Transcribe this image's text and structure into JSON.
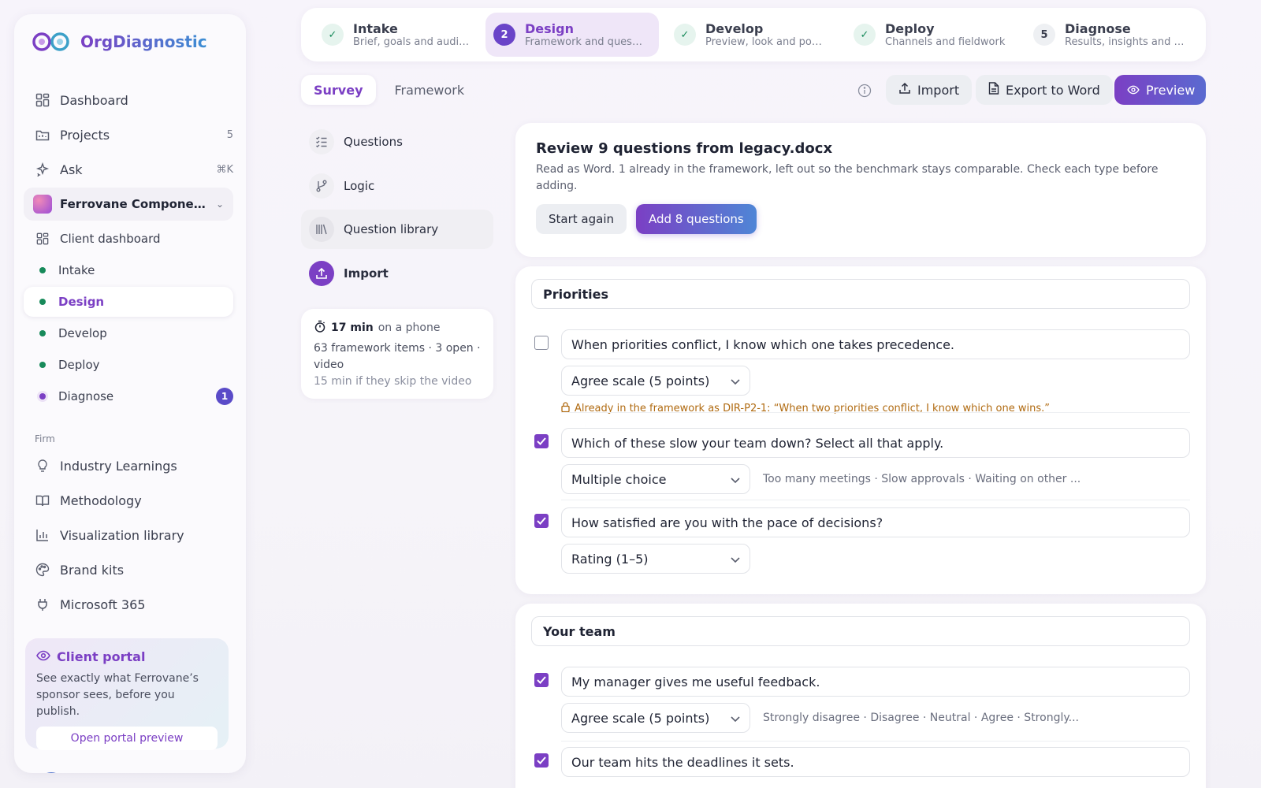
{
  "brand": {
    "name": "OrgDiagnostic"
  },
  "nav": [
    {
      "label": "Dashboard",
      "icon": "dashboard-icon"
    },
    {
      "label": "Projects",
      "icon": "folder-icon",
      "count": "5"
    },
    {
      "label": "Ask",
      "icon": "sparkle-icon",
      "count": "⌘K"
    }
  ],
  "client": {
    "name": "Ferrovane Compone..."
  },
  "client_nav": [
    {
      "label": "Client dashboard"
    },
    {
      "label": "Intake"
    },
    {
      "label": "Design"
    },
    {
      "label": "Develop"
    },
    {
      "label": "Deploy"
    },
    {
      "label": "Diagnose",
      "badge": "1"
    }
  ],
  "firm": {
    "label": "Firm",
    "items": [
      {
        "label": "Industry Learnings",
        "icon": "lightbulb-icon"
      },
      {
        "label": "Methodology",
        "icon": "book-icon"
      },
      {
        "label": "Visualization library",
        "icon": "bar-chart-icon"
      },
      {
        "label": "Brand kits",
        "icon": "palette-icon"
      },
      {
        "label": "Microsoft 365",
        "icon": "plug-icon"
      }
    ]
  },
  "portal": {
    "title": "Client portal",
    "desc": "See exactly what Ferrovane’s sponsor sees, before you publish.",
    "button": "Open portal preview"
  },
  "steps": [
    {
      "title": "Intake",
      "sub": "Brief, goals and audie...",
      "state": "done"
    },
    {
      "title": "Design",
      "sub": "Framework and questi...",
      "state": "current",
      "num": "2"
    },
    {
      "title": "Develop",
      "sub": "Preview, look and pop...",
      "state": "done"
    },
    {
      "title": "Deploy",
      "sub": "Channels and fieldwork",
      "state": "done"
    },
    {
      "title": "Diagnose",
      "sub": "Results, insights and r...",
      "state": "todo",
      "num": "5"
    }
  ],
  "tabs": {
    "survey": "Survey",
    "framework": "Framework"
  },
  "toolbar": {
    "import": "Import",
    "export": "Export to Word",
    "preview": "Preview"
  },
  "left_nav": [
    {
      "label": "Questions"
    },
    {
      "label": "Logic"
    },
    {
      "label": "Question library"
    },
    {
      "label": "Import"
    }
  ],
  "timecard": {
    "minutes": "17 min",
    "device": "on a phone",
    "line2": "63 framework items · 3 open · video",
    "line3": "15 min if they skip the video"
  },
  "review": {
    "title": "Review 9 questions from legacy.docx",
    "desc": "Read as Word. 1 already in the framework, left out so the benchmark stays comparable. Check each type before adding.",
    "start_again": "Start again",
    "add": "Add 8 questions"
  },
  "sections": [
    {
      "title": "Priorities",
      "questions": [
        {
          "text": "When priorities conflict, I know which one takes precedence.",
          "type": "Agree scale (5 points)",
          "checked": false,
          "warning": "Already in the framework as DIR-P2-1: “When two priorities conflict, I know which one wins.”"
        },
        {
          "text": "Which of these slow your team down? Select all that apply.",
          "type": "Multiple choice",
          "checked": true,
          "options": "Too many meetings · Slow approvals · Waiting on other ..."
        },
        {
          "text": "How satisfied are you with the pace of decisions?",
          "type": "Rating (1–5)",
          "checked": true
        }
      ]
    },
    {
      "title": "Your team",
      "questions": [
        {
          "text": "My manager gives me useful feedback.",
          "type": "Agree scale (5 points)",
          "checked": true,
          "options": "Strongly disagree · Disagree · Neutral · Agree · Strongly..."
        },
        {
          "text": "Our team hits the deadlines it sets.",
          "checked": true
        }
      ]
    }
  ]
}
